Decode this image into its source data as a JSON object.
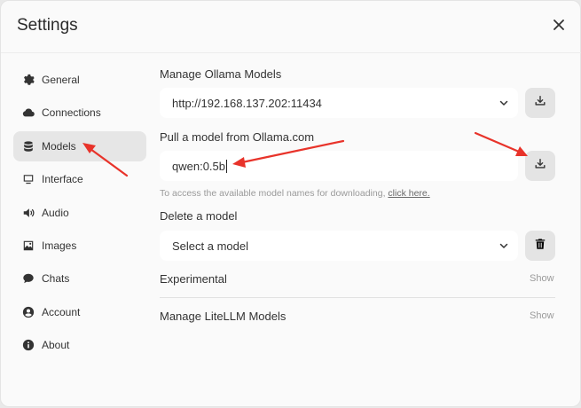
{
  "window": {
    "title": "Settings"
  },
  "sidebar": {
    "items": [
      {
        "label": "General",
        "icon": "gear-icon"
      },
      {
        "label": "Connections",
        "icon": "cloud-icon"
      },
      {
        "label": "Models",
        "icon": "database-icon",
        "active": true
      },
      {
        "label": "Interface",
        "icon": "monitor-icon"
      },
      {
        "label": "Audio",
        "icon": "speaker-icon"
      },
      {
        "label": "Images",
        "icon": "image-icon"
      },
      {
        "label": "Chats",
        "icon": "chat-icon"
      },
      {
        "label": "Account",
        "icon": "user-icon"
      },
      {
        "label": "About",
        "icon": "info-icon"
      }
    ]
  },
  "models": {
    "manage_title": "Manage Ollama Models",
    "server_url": "http://192.168.137.202:11434",
    "pull_title": "Pull a model from Ollama.com",
    "pull_value": "qwen:0.5b",
    "hint_text": "To access the available model names for downloading,",
    "hint_link": "click here.",
    "delete_title": "Delete a model",
    "delete_placeholder": "Select a model",
    "experimental_label": "Experimental",
    "experimental_show": "Show",
    "litellm_label": "Manage LiteLLM Models",
    "litellm_show": "Show"
  },
  "colors": {
    "annotation_arrow": "#e8332a"
  }
}
